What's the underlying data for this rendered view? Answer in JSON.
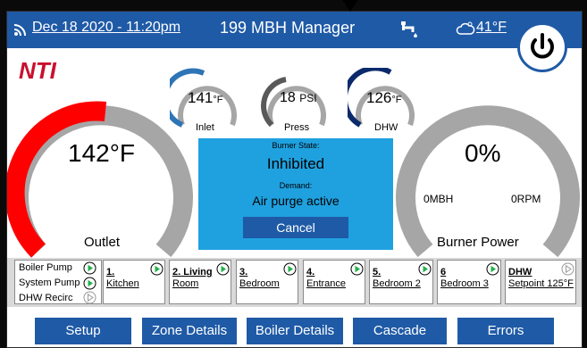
{
  "header": {
    "date_time": "Dec 18 2020 - 11:20pm",
    "title": "199 MBH Manager",
    "outdoor_temp": "41°F",
    "color": "#1f5aa6"
  },
  "brand": {
    "logo_text": "NTI",
    "color": "#c8102e"
  },
  "gauges": {
    "inlet": {
      "value": "141",
      "unit": "°F",
      "label": "Inlet",
      "fill": 0.5
    },
    "press": {
      "value": "18",
      "unit": "PSI",
      "label": "Press",
      "fill": 0.4
    },
    "dhw": {
      "value": "126",
      "unit": "°F",
      "label": "DHW",
      "fill": 0.55
    },
    "outlet": {
      "value": "142°F",
      "label": "Outlet",
      "fill": 0.55,
      "color": "#ff0000"
    },
    "burner": {
      "value": "0%",
      "mbh": "0MBH",
      "rpm": "0RPM",
      "label": "Burner Power",
      "fill": 0
    }
  },
  "burner_state": {
    "label": "Burner State:",
    "state": "Inhibited",
    "demand_label": "Demand:",
    "demand": "Air purge active",
    "cancel_label": "Cancel",
    "color": "#1fa1df"
  },
  "pumps": [
    {
      "label": "Boiler Pump",
      "active": true
    },
    {
      "label": "System Pump",
      "active": true
    },
    {
      "label": "DHW Recirc",
      "active": false
    }
  ],
  "zones": [
    {
      "num": "1.",
      "name": "Kitchen",
      "active": true
    },
    {
      "num": "2. Living",
      "name": "Room",
      "active": true
    },
    {
      "num": "3.",
      "name": "Bedroom",
      "active": true
    },
    {
      "num": "4.",
      "name": "Entrance",
      "active": true
    },
    {
      "num": "5.",
      "name": "Bedroom 2",
      "active": true
    },
    {
      "num": "6",
      "name": "Bedroom 3",
      "active": true
    },
    {
      "num": "DHW",
      "name": "Setpoint 125°F",
      "active": false
    }
  ],
  "nav": [
    "Setup",
    "Zone Details",
    "Boiler Details",
    "Cascade",
    "Errors"
  ],
  "colors": {
    "active_play": "#22b14c",
    "gauge_track": "#a6a6a6",
    "inlet_arc": "#2e75b6",
    "press_arc": "#595959",
    "dhw_arc": "#0b2a6b"
  }
}
